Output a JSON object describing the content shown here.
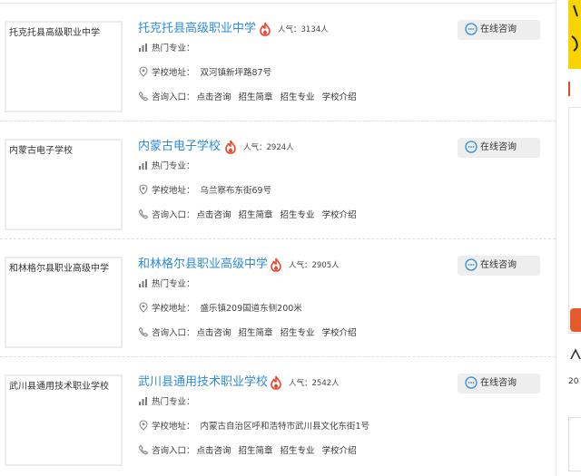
{
  "labels": {
    "hot_major": "热门专业：",
    "address": "学校地址：",
    "consult_entry": "咨询入口：",
    "links": [
      "点击咨询",
      "招生简章",
      "招生专业",
      "学校介绍"
    ],
    "consult_button": "在线咨询"
  },
  "schools": [
    {
      "thumb_text": "托克托县高级职业中学",
      "name": "托克托县高级职业中学",
      "popularity": "人气：3134人",
      "address": "双河镇新坪路87号"
    },
    {
      "thumb_text": "内蒙古电子学校",
      "name": "内蒙古电子学校",
      "popularity": "人气：2924人",
      "address": "乌兰察布东街69号"
    },
    {
      "thumb_text": "和林格尔县职业高级中学",
      "name": "和林格尔县职业高级中学",
      "popularity": "人气：2905人",
      "address": "盛乐镇209国道东侧200米"
    },
    {
      "thumb_text": "武川县通用技术职业学校",
      "name": "武川县通用技术职业学校",
      "popularity": "人气：2542人",
      "address": "内蒙古自治区呼和浩特市武川县文化东街1号"
    }
  ],
  "sidebar": {
    "partial_text": "20"
  },
  "colors": {
    "link": "#2d8bd8",
    "fire": "#e8452c",
    "banner": "#f7d400"
  }
}
